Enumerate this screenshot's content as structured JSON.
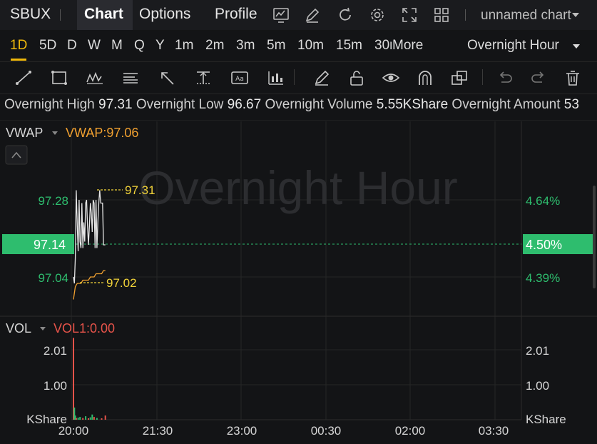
{
  "topbar": {
    "symbol": "SBUX",
    "tabs": [
      "Chart",
      "Options",
      "Profile"
    ],
    "active_tab": "Chart",
    "chart_name": "unnamed chart"
  },
  "periods": {
    "items": [
      "1D",
      "5D",
      "D",
      "W",
      "M",
      "Q",
      "Y",
      "1m",
      "2m",
      "3m",
      "5m",
      "10m",
      "15m",
      "30r"
    ],
    "active": "1D",
    "more_label": "More",
    "session_label": "Overnight Hour"
  },
  "info": {
    "high_label": "Overnight High",
    "high_value": "97.31",
    "low_label": "Overnight Low",
    "low_value": "96.67",
    "volume_label": "Overnight Volume",
    "volume_value": "5.55KShare",
    "amount_label": "Overnight Amount",
    "amount_value": "53"
  },
  "price_panel": {
    "indicator_name": "VWAP",
    "indicator_value": "VWAP:97.06",
    "watermark": "Overnight Hour",
    "left_labels": [
      "97.28",
      "97.04"
    ],
    "right_labels": [
      "4.64%",
      "4.39%"
    ],
    "current_price": "97.14",
    "current_pct": "4.50%",
    "high_marker": "97.31",
    "low_marker": "97.02"
  },
  "volume_panel": {
    "indicator_name": "VOL",
    "indicator_value": "VOL1:0.00",
    "left_labels": [
      "2.01",
      "1.00",
      "KShare"
    ],
    "right_labels": [
      "2.01",
      "1.00",
      "KShare"
    ]
  },
  "xaxis": {
    "labels": [
      "20:00",
      "21:30",
      "23:00",
      "00:30",
      "02:00",
      "03:30"
    ]
  },
  "colors": {
    "green": "#2ebd6e",
    "orange": "#f0a030",
    "yellow": "#f2d33a",
    "red": "#e6534a",
    "accent": "#2a7df0"
  },
  "chart_data": {
    "type": "line",
    "series": [
      {
        "name": "VWAP",
        "x": [
          "20:00",
          "20:02",
          "20:04",
          "20:06",
          "20:08",
          "20:10",
          "20:12",
          "20:14",
          "20:16",
          "20:18",
          "20:20",
          "20:22",
          "20:24",
          "20:26",
          "20:28",
          "20:30",
          "20:32",
          "20:34"
        ],
        "values": [
          96.97,
          97.01,
          97.02,
          97.02,
          97.02,
          97.03,
          97.03,
          97.03,
          97.03,
          97.04,
          97.04,
          97.04,
          97.05,
          97.05,
          97.05,
          97.05,
          97.06,
          97.06
        ]
      }
    ],
    "price_series": {
      "x": [
        "20:00",
        "20:01",
        "20:02",
        "20:03",
        "20:04",
        "20:05",
        "20:06",
        "20:07",
        "20:08",
        "20:09",
        "20:10",
        "20:11",
        "20:12",
        "20:13",
        "20:14",
        "20:15",
        "20:16",
        "20:17",
        "20:18",
        "20:19",
        "20:20",
        "20:21",
        "20:22",
        "20:23",
        "20:24",
        "20:25",
        "20:26",
        "20:27",
        "20:28",
        "20:29",
        "20:30",
        "20:31",
        "20:32",
        "20:33",
        "20:34"
      ],
      "values": [
        97.04,
        97.02,
        97.1,
        97.31,
        97.2,
        97.12,
        97.28,
        97.15,
        97.13,
        97.27,
        97.13,
        97.21,
        97.15,
        97.27,
        97.28,
        97.2,
        97.14,
        97.2,
        97.27,
        97.24,
        97.18,
        97.28,
        97.27,
        97.13,
        97.28,
        97.13,
        97.21,
        97.27,
        97.31,
        97.27,
        97.27,
        97.27,
        97.14,
        97.14,
        97.14
      ]
    },
    "volume": {
      "x": [
        "20:00",
        "20:01",
        "20:02",
        "20:03",
        "20:05",
        "20:07",
        "20:10",
        "20:13",
        "20:16",
        "20:18",
        "20:20",
        "20:22",
        "20:25",
        "20:30",
        "20:34"
      ],
      "values": [
        2.35,
        0.35,
        0.12,
        0.05,
        0.06,
        0.08,
        0.05,
        0.1,
        0.04,
        0.07,
        0.15,
        0.08,
        0.05,
        0.04,
        0.12
      ],
      "up": [
        false,
        true,
        true,
        false,
        true,
        true,
        false,
        true,
        false,
        true,
        true,
        false,
        true,
        false,
        false
      ]
    },
    "ylim": [
      96.95,
      97.4
    ],
    "vol_ylim": [
      0,
      2.45
    ]
  }
}
